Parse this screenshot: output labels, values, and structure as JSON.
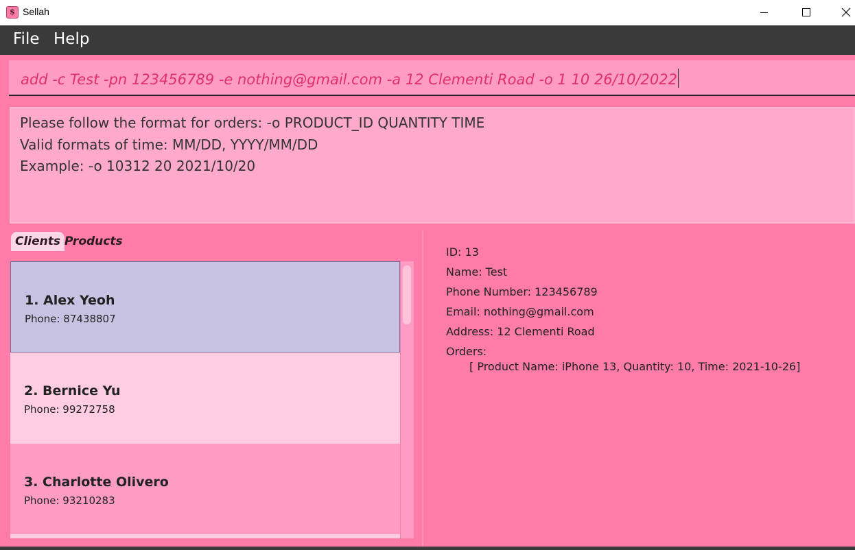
{
  "window": {
    "title": "Sellah",
    "icon": "dollar-icon"
  },
  "menu": {
    "file": "File",
    "help": "Help"
  },
  "command": {
    "value": "add -c Test -pn 123456789 -e nothing@gmail.com -a 12 Clementi Road -o 1 10 26/10/2022"
  },
  "result": {
    "lines": [
      "Please follow the format for orders: -o PRODUCT_ID QUANTITY TIME",
      "Valid formats of time: MM/DD, YYYY/MM/DD",
      "Example: -o 10312 20 2021/10/20"
    ]
  },
  "tabs": {
    "clients": "Clients",
    "products": "Products",
    "selected": "Clients"
  },
  "clients": [
    {
      "name": "1.  Alex Yeoh",
      "phone": "Phone: 87438807",
      "selected": true
    },
    {
      "name": "2.  Bernice Yu",
      "phone": "Phone: 99272758",
      "selected": false
    },
    {
      "name": "3.  Charlotte Olivero",
      "phone": "Phone: 93210283",
      "selected": false
    }
  ],
  "detail": {
    "id": "ID: 13",
    "name": "Name: Test",
    "phone": "Phone Number: 123456789",
    "email": "Email: nothing@gmail.com",
    "address": "Address: 12 Clementi Road",
    "orders_label": "Orders:",
    "orders": [
      "[ Product Name: iPhone 13, Quantity: 10, Time: 2021-10-26]"
    ]
  },
  "colors": {
    "accent": "#ff7ba8",
    "selected_card": "#c8c3e2",
    "card_light": "#ffcde2",
    "card_medium": "#ff9cc4",
    "menubar": "#3a3a3a",
    "command_text": "#e0306a"
  }
}
